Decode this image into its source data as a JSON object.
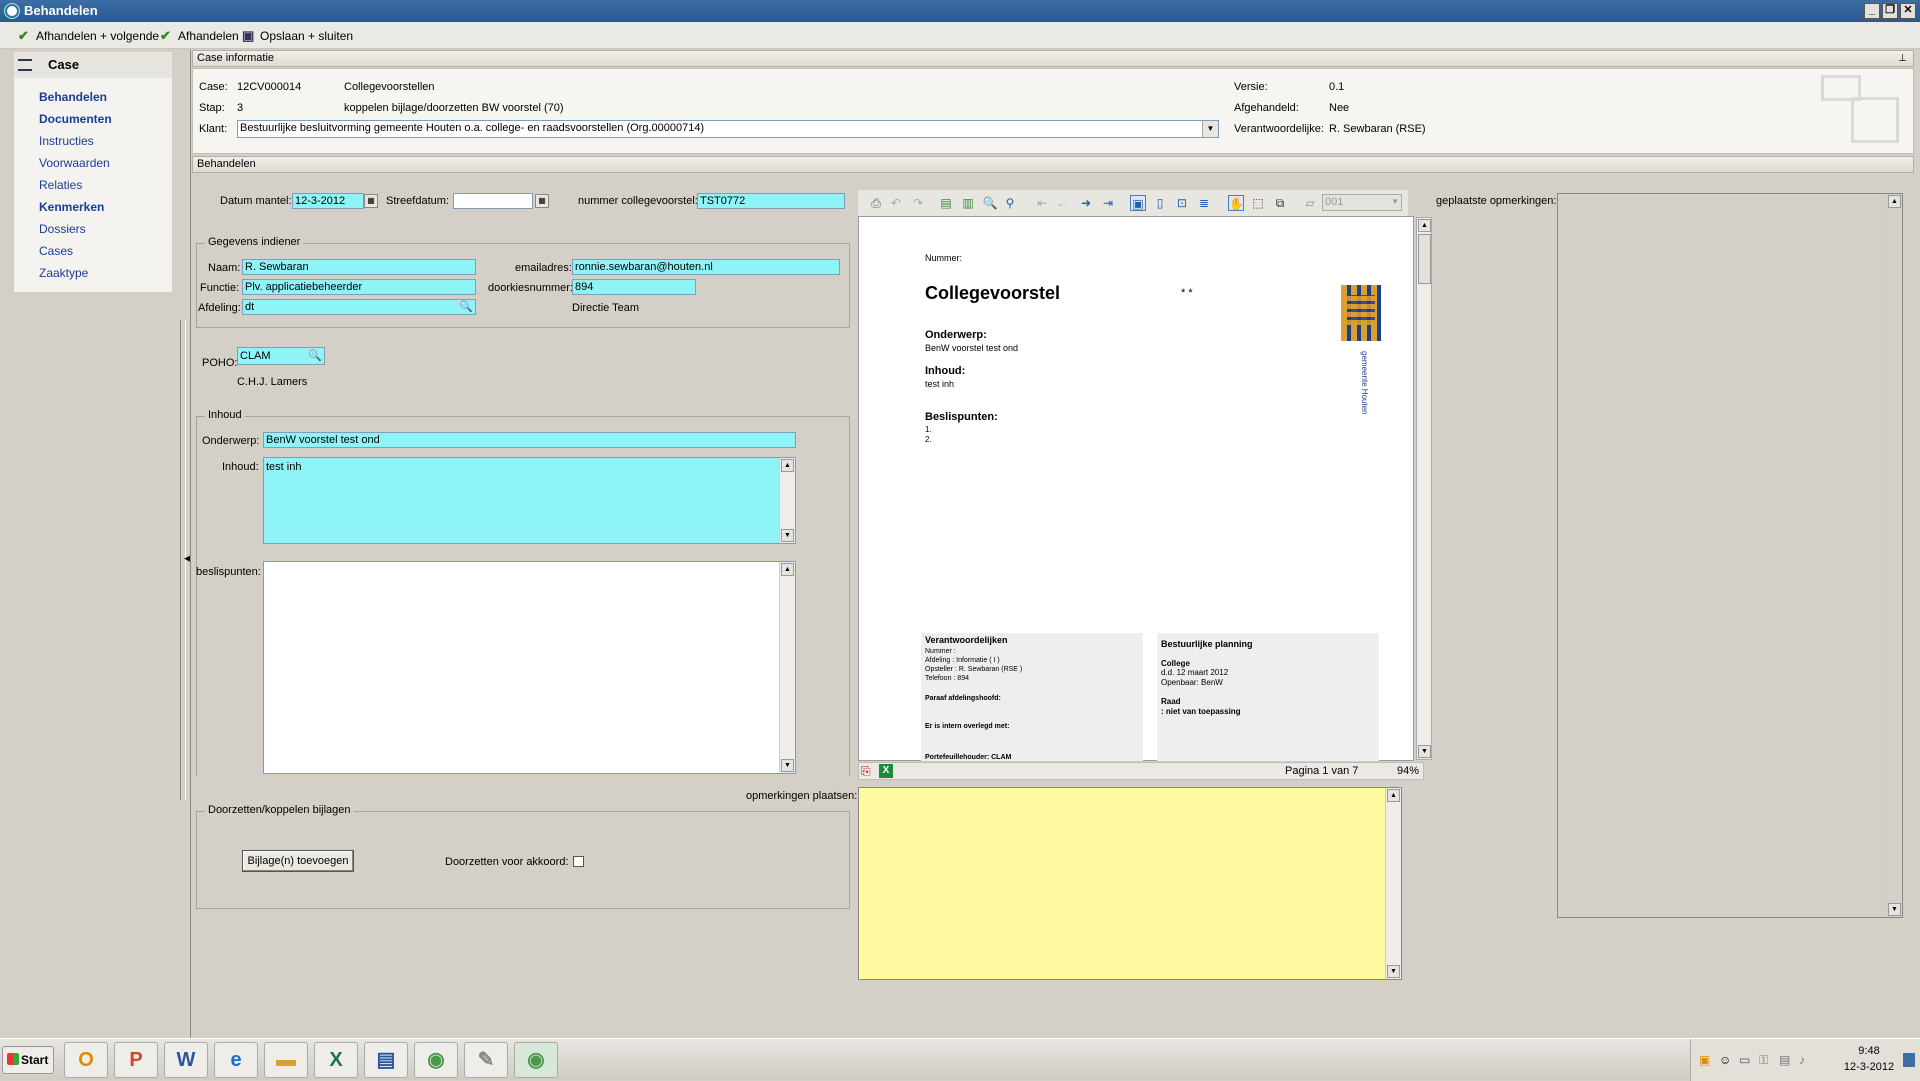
{
  "window": {
    "title": "Behandelen"
  },
  "toolbar": {
    "btn1": "Afhandelen + volgende",
    "btn2": "Afhandelen",
    "btn3": "Opslaan + sluiten"
  },
  "sidebar": {
    "header": "Case",
    "items": [
      {
        "label": "Behandelen",
        "bold": true
      },
      {
        "label": "Documenten",
        "bold": true
      },
      {
        "label": "Instructies",
        "bold": false
      },
      {
        "label": "Voorwaarden",
        "bold": false
      },
      {
        "label": "Relaties",
        "bold": false
      },
      {
        "label": "Kenmerken",
        "bold": true
      },
      {
        "label": "Dossiers",
        "bold": false
      },
      {
        "label": "Cases",
        "bold": false
      },
      {
        "label": "Zaaktype",
        "bold": false
      }
    ]
  },
  "case_info": {
    "section_title": "Case informatie",
    "case_label": "Case:",
    "case_value": "12CV000014",
    "case_name": "Collegevoorstellen",
    "stap_label": "Stap:",
    "stap_value": "3",
    "stap_name": "koppelen bijlage/doorzetten BW voorstel (70)",
    "klant_label": "Klant:",
    "klant_value": "Bestuurlijke besluitvorming gemeente Houten o.a. college- en raadsvoorstellen (Org.00000714)",
    "versie_label": "Versie:",
    "versie_value": "0.1",
    "afgehandeld_label": "Afgehandeld:",
    "afgehandeld_value": "Nee",
    "verantwoordelijke_label": "Verantwoordelijke:",
    "verantwoordelijke_value": "R. Sewbaran (RSE)"
  },
  "behandelen": {
    "section_title": "Behandelen",
    "datum_mantel_label": "Datum mantel:",
    "datum_mantel_value": "12-3-2012",
    "streefdatum_label": "Streefdatum:",
    "streefdatum_value": "",
    "nummer_label": "nummer collegevoorstel:",
    "nummer_value": "TST0772",
    "indiener": {
      "title": "Gegevens indiener",
      "naam_label": "Naam:",
      "naam_value": "R. Sewbaran",
      "email_label": "emailadres:",
      "email_value": "ronnie.sewbaran@houten.nl",
      "functie_label": "Functie:",
      "functie_value": "Plv. applicatiebeheerder",
      "doorkies_label": "doorkiesnummer:",
      "doorkies_value": "894",
      "afdeling_label": "Afdeling:",
      "afdeling_value": "dt",
      "afdeling_name": "Directie Team"
    },
    "poho_label": "POHO:",
    "poho_value": "CLAM",
    "poho_name": "C.H.J. Lamers",
    "inhoud": {
      "title": "Inhoud",
      "onderwerp_label": "Onderwerp:",
      "onderwerp_value": "BenW voorstel test ond",
      "inhoud_label": "Inhoud:",
      "inhoud_value": "test inh"
    },
    "beslispunten_label": "beslispunten:",
    "beslispunten_value": "",
    "doorzetten": {
      "title": "Doorzetten/koppelen bijlagen",
      "bijlage_button": "Bijlage(n) toevoegen",
      "akkoord_label": "Doorzetten voor akkoord:",
      "akkoord_checked": false
    },
    "opmerkingen_plaatsen_label": "opmerkingen plaatsen:",
    "geplaatste_label": "geplaatste opmerkingen:"
  },
  "viewer": {
    "page_select": "001",
    "page_status": "Pagina 1 van 7",
    "zoom": "94%",
    "doc": {
      "nummer": "Nummer:",
      "title": "Collegevoorstel",
      "stars": "* *",
      "onderwerp_h": "Onderwerp:",
      "onderwerp_v": "BenW voorstel test ond",
      "inhoud_h": "Inhoud:",
      "inhoud_v": "test inh",
      "beslispunten_h": "Beslispunten:",
      "b1": "1.",
      "b2": "2.",
      "logo_text": "gemeente Houten",
      "verantw_h": "Verantwoordelijken",
      "verantw_l1": "Nummer        :",
      "verantw_l2": "Afdeling      : Informatie ( I )",
      "verantw_l3": "Opsteller     : R. Sewbaran (RSE )",
      "verantw_l4": "Telefoon      : 894",
      "paraaf": "Paraaf afdelingshoofd:",
      "overleg": "Er is intern overlegd met:",
      "portef": "Portefeuillehouder: CLAM",
      "planning_h": "Bestuurlijke planning",
      "college_h": "College",
      "college_l1": "d.d. 12 maart 2012",
      "college_l2": "Openbaar: BenW",
      "raad_h": "Raad",
      "raad_l1": ": niet van toepassing"
    }
  },
  "taskbar": {
    "start": "Start",
    "time": "9:48",
    "date": "12-3-2012"
  }
}
